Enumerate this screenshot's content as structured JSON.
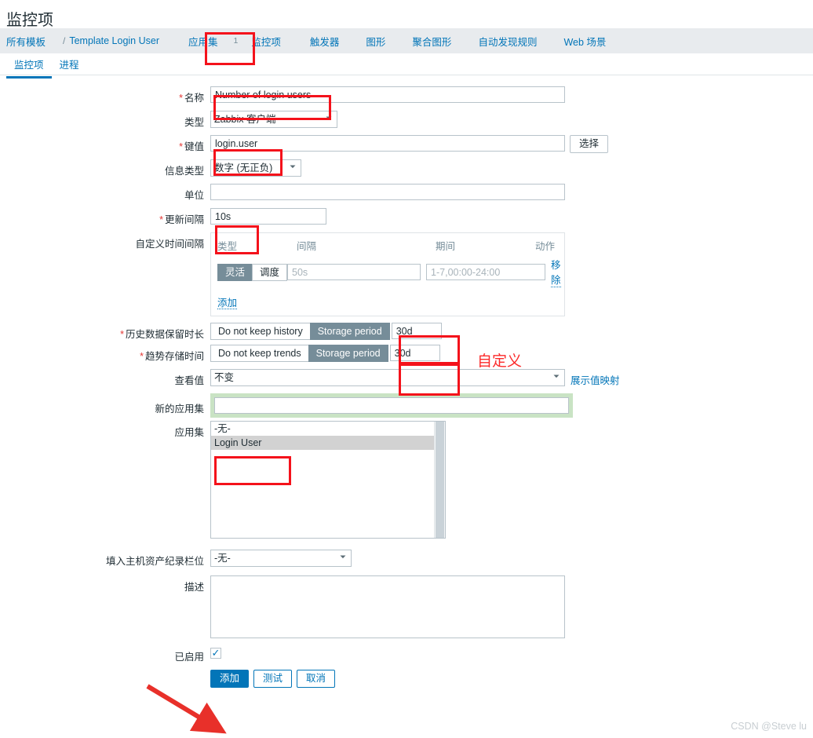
{
  "page": {
    "title": "监控项"
  },
  "nav": {
    "breadcrumb": {
      "root": "所有模板",
      "separator": "/",
      "current": "Template Login User"
    },
    "items": [
      {
        "label": "应用集",
        "count": "1"
      },
      {
        "label": "监控项",
        "count": ""
      },
      {
        "label": "触发器",
        "count": ""
      },
      {
        "label": "图形",
        "count": ""
      },
      {
        "label": "聚合图形",
        "count": ""
      },
      {
        "label": "自动发现规则",
        "count": ""
      },
      {
        "label": "Web 场景",
        "count": ""
      }
    ]
  },
  "subtabs": [
    {
      "label": "监控项",
      "active": true
    },
    {
      "label": "进程",
      "active": false
    }
  ],
  "form": {
    "name": {
      "label": "名称",
      "required": true,
      "value": "Number of login users"
    },
    "type": {
      "label": "类型",
      "required": false,
      "value": "Zabbix 客户端"
    },
    "key": {
      "label": "键值",
      "required": true,
      "value": "login.user",
      "select_button": "选择"
    },
    "value_type": {
      "label": "信息类型",
      "required": false,
      "value": "数字 (无正负)"
    },
    "units": {
      "label": "单位",
      "required": false,
      "value": "",
      "placeholder": ""
    },
    "update_interval": {
      "label": "更新间隔",
      "required": true,
      "value": "10s"
    },
    "custom_intervals": {
      "label": "自定义时间间隔",
      "columns": {
        "type": "类型",
        "interval": "间隔",
        "period": "期间",
        "action": "动作"
      },
      "rows": [
        {
          "type_options": [
            "灵活",
            "调度"
          ],
          "type_selected": "灵活",
          "interval_value": "",
          "interval_placeholder": "50s",
          "period_value": "",
          "period_placeholder": "1-7,00:00-24:00",
          "action_label": "移除"
        }
      ],
      "add_label": "添加"
    },
    "history": {
      "label": "历史数据保留时长",
      "required": true,
      "options": [
        "Do not keep history",
        "Storage period"
      ],
      "selected": "Storage period",
      "value": "30d"
    },
    "trends": {
      "label": "趋势存储时间",
      "required": true,
      "options": [
        "Do not keep trends",
        "Storage period"
      ],
      "selected": "Storage period",
      "value": "30d"
    },
    "value_map": {
      "label": "查看值",
      "value": "不变",
      "link": "展示值映射"
    },
    "new_application": {
      "label": "新的应用集",
      "value": "",
      "placeholder": ""
    },
    "applications": {
      "label": "应用集",
      "options": [
        {
          "label": "-无-",
          "selected": false
        },
        {
          "label": "Login User",
          "selected": true
        }
      ]
    },
    "inventory_field": {
      "label": "填入主机资产纪录栏位",
      "value": "-无-"
    },
    "description": {
      "label": "描述",
      "value": "",
      "placeholder": ""
    },
    "enabled": {
      "label": "已启用",
      "checked": true
    }
  },
  "footer": {
    "buttons": [
      {
        "label": "添加",
        "primary": true
      },
      {
        "label": "测试",
        "primary": false
      },
      {
        "label": "取消",
        "primary": false
      }
    ]
  },
  "annotations": {
    "custom_text": "自定义",
    "colors": {
      "highlight": "#f4121b",
      "note": "#fb2a2a",
      "accent": "#0275b8",
      "segment_active": "#768d99"
    }
  },
  "watermark": "CSDN @Steve lu"
}
